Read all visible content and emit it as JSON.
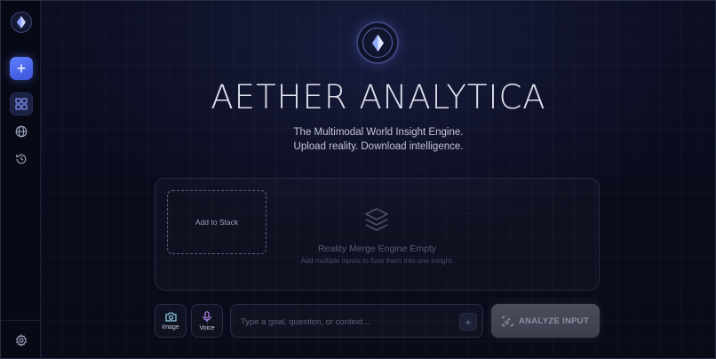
{
  "app": {
    "title": "AETHER ANALYTICA",
    "tagline_line1": "The Multimodal World Insight Engine.",
    "tagline_line2": "Upload reality. Download intelligence."
  },
  "sidebar": {
    "items": [
      {
        "name": "logo",
        "icon": "diamond-logo-icon"
      },
      {
        "name": "new",
        "icon": "plus-icon"
      },
      {
        "name": "dashboard",
        "icon": "grid-icon",
        "active": true
      },
      {
        "name": "explore",
        "icon": "globe-icon"
      },
      {
        "name": "history",
        "icon": "history-icon"
      },
      {
        "name": "settings",
        "icon": "gear-icon"
      }
    ]
  },
  "stack": {
    "add_label": "Add to Stack",
    "empty_title": "Reality Merge Engine Empty",
    "empty_subtitle": "Add multiple inputs to fuse them into one insight."
  },
  "composer": {
    "image_label": "Image",
    "voice_label": "Voice",
    "placeholder": "Type a goal, question, or context...",
    "input_value": "",
    "analyze_label": "ANALYZE INPUT"
  },
  "colors": {
    "accent": "#4f6bf0",
    "background": "#0b0e20",
    "image_icon": "#8fd3ee",
    "voice_icon": "#b98cf5"
  }
}
